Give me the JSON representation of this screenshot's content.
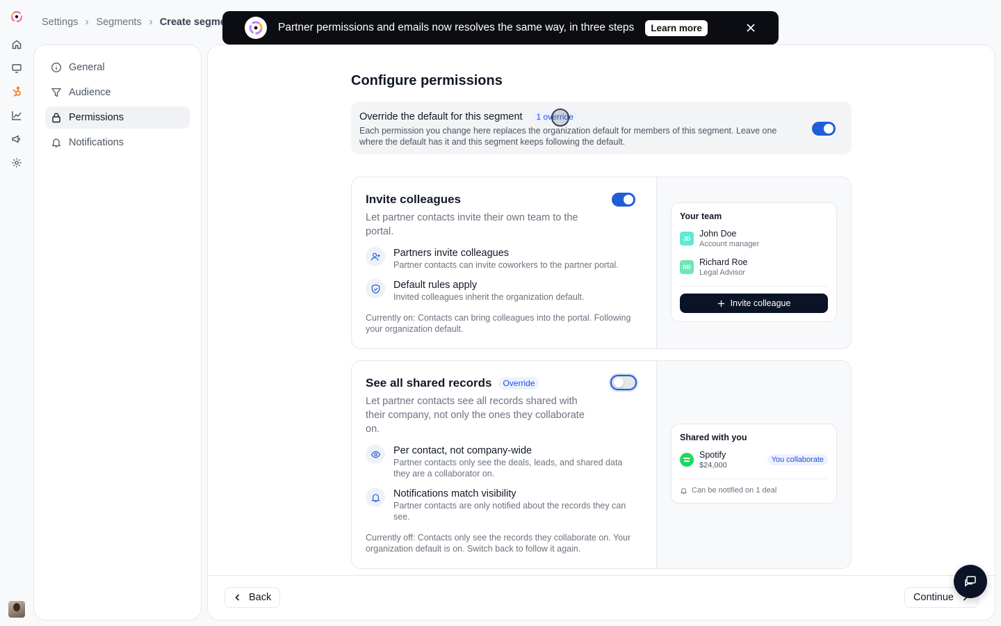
{
  "breadcrumbs": [
    "Settings",
    "Segments",
    "Create segment"
  ],
  "banner": {
    "message": "Partner permissions and emails now resolves the same way, in three steps",
    "learn_more": "Learn more"
  },
  "sidebar": {
    "items": [
      {
        "label": "General",
        "icon": "info-icon"
      },
      {
        "label": "Audience",
        "icon": "filter-icon"
      },
      {
        "label": "Permissions",
        "icon": "lock-icon",
        "active": true
      },
      {
        "label": "Notifications",
        "icon": "bell-icon"
      }
    ]
  },
  "page": {
    "title": "Configure permissions",
    "override": {
      "title": "Override the default for this segment",
      "badge": "1 override",
      "description": "Each permission you change here replaces the organization default for members of this segment. Leave one where the default has it and this segment keeps following the default.",
      "enabled": true
    },
    "permissions": [
      {
        "title": "Invite colleagues",
        "badge": "",
        "enabled": true,
        "lead": "Let partner contacts invite their own team to the portal.",
        "features": [
          {
            "icon": "user-plus-icon",
            "title": "Partners invite colleagues",
            "desc": "Partner contacts can invite coworkers to the partner portal."
          },
          {
            "icon": "shield-check-icon",
            "title": "Default rules apply",
            "desc": "Invited colleagues inherit the organization default."
          }
        ],
        "status": "Currently on: Contacts can bring colleagues into the portal. Following your organization default.",
        "preview": {
          "title": "Your team",
          "people": [
            {
              "initials": "JD",
              "name": "John Doe",
              "role": "Account manager"
            },
            {
              "initials": "RR",
              "name": "Richard Roe",
              "role": "Legal Advisor"
            }
          ],
          "button": "Invite colleague"
        }
      },
      {
        "title": "See all shared records",
        "badge": "Override",
        "enabled": false,
        "lead": "Let partner contacts see all records shared with their company, not only the ones they collaborate on.",
        "features": [
          {
            "icon": "eye-icon",
            "title": "Per contact, not company-wide",
            "desc": "Partner contacts only see the deals, leads, and shared data they are a collaborator on."
          },
          {
            "icon": "bell-icon",
            "title": "Notifications match visibility",
            "desc": "Partner contacts are only notified about the records they can see."
          }
        ],
        "status": "Currently off: Contacts only see the records they collaborate on. Your organization default is on. Switch back to follow it again.",
        "preview": {
          "title": "Shared with you",
          "record_name": "Spotify",
          "record_value": "$24,000",
          "record_badge": "You collaborate",
          "notice": "Can be notified on 1 deal"
        }
      }
    ]
  },
  "footer": {
    "back": "Back",
    "continue": "Continue"
  },
  "colors": {
    "accent": "#1f5ed6",
    "dark": "#0b1426",
    "banner_bg": "#0b0d12"
  }
}
